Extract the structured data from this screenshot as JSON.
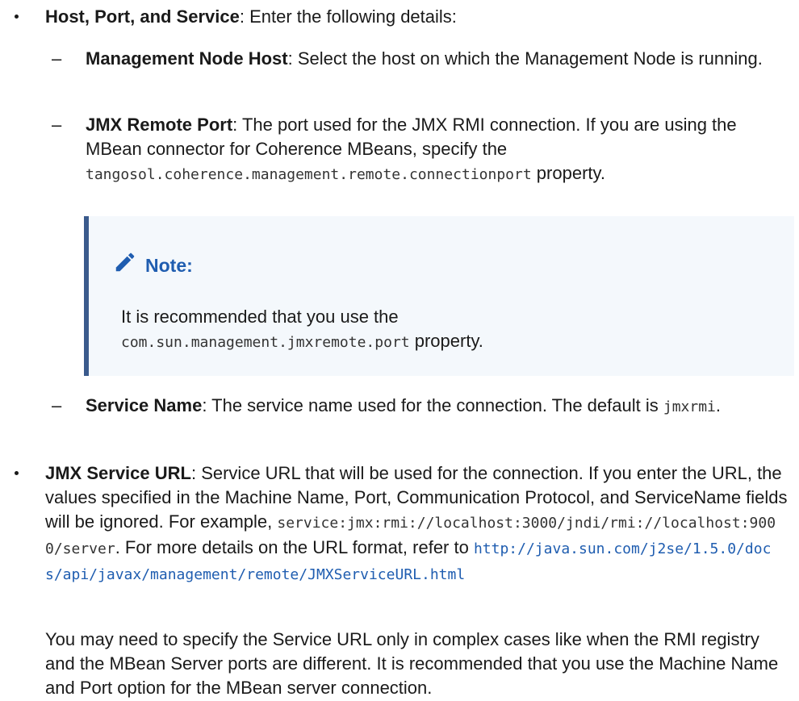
{
  "bullet1": {
    "label": "Host, Port, and Service",
    "text": ": Enter the following details:"
  },
  "sub1": {
    "label": "Management Node Host",
    "text": ": Select the host on which the Management Node is running."
  },
  "sub2": {
    "label": "JMX Remote Port",
    "text": ": The port used for the JMX RMI connection. If you are using the MBean connector for Coherence MBeans, specify the ",
    "code": "tangosol.coherence.management.remote.connectionport",
    "tail": " property."
  },
  "note": {
    "icon": "pencil-icon",
    "title": "Note:",
    "text": "It is recommended that you use the",
    "code": "com.sun.management.jmxremote.port",
    "tail": " property."
  },
  "sub3": {
    "label": "Service Name",
    "text": ": The service name used for the connection. The default is ",
    "code": "jmxrmi",
    "tail": "."
  },
  "bullet2": {
    "label": "JMX Service URL",
    "text": ": Service URL that will be used for the connection. If you enter the URL, the values specified in the Machine Name, Port, Communication Protocol, and ServiceName fields will be ignored. For example, ",
    "code": "service:jmx:rmi://localhost:3000/jndi/rmi://localhost:9000/server",
    "mid": ". For more details on the URL format, refer to ",
    "link": "http://java.sun.com/j2se/1.5.0/docs/api/javax/management/remote/JMXServiceURL.html"
  },
  "para": {
    "text": "You may need to specify the Service URL only in complex cases like when the RMI registry and the MBean Server ports are different. It is recommended that you use the Machine Name and Port option for the MBean server connection."
  },
  "colors": {
    "accent": "#1f5db0",
    "note_bg": "#f4f8fc",
    "note_bar": "#3a5a8c"
  }
}
